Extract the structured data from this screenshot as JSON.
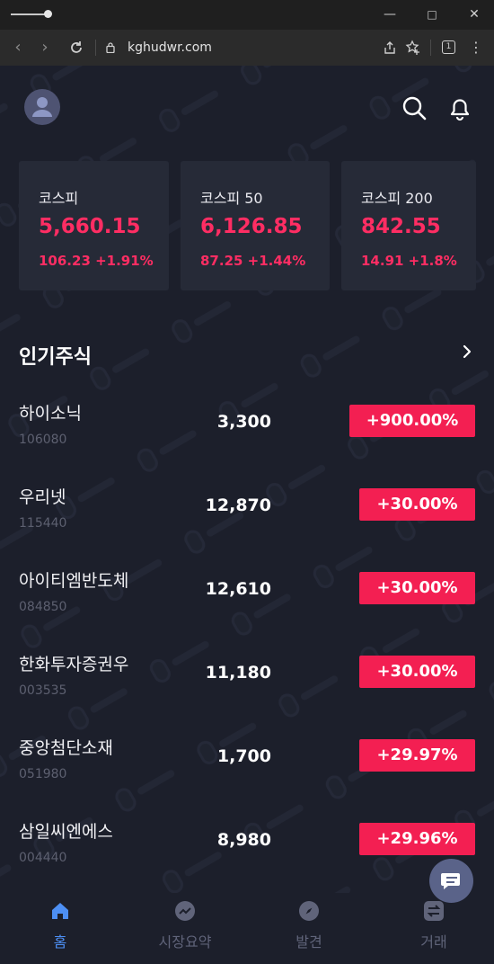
{
  "browser": {
    "url": "kghudwr.com",
    "tab_count": "1"
  },
  "indices": [
    {
      "name": "코스피",
      "value": "5,660.15",
      "change": "106.23 +1.91%"
    },
    {
      "name": "코스피 50",
      "value": "6,126.85",
      "change": "87.25 +1.44%"
    },
    {
      "name": "코스피 200",
      "value": "842.55",
      "change": "14.91 +1.8%"
    }
  ],
  "popular": {
    "title": "인기주식",
    "stocks": [
      {
        "name": "하이소닉",
        "code": "106080",
        "price": "3,300",
        "change": "+900.00%"
      },
      {
        "name": "우리넷",
        "code": "115440",
        "price": "12,870",
        "change": "+30.00%"
      },
      {
        "name": "아이티엠반도체",
        "code": "084850",
        "price": "12,610",
        "change": "+30.00%"
      },
      {
        "name": "한화투자증권우",
        "code": "003535",
        "price": "11,180",
        "change": "+30.00%"
      },
      {
        "name": "중앙첨단소재",
        "code": "051980",
        "price": "1,700",
        "change": "+29.97%"
      },
      {
        "name": "삼일씨엔에스",
        "code": "004440",
        "price": "8,980",
        "change": "+29.96%"
      }
    ]
  },
  "bottom_nav": [
    {
      "label": "홈",
      "icon": "home-icon",
      "active": true
    },
    {
      "label": "시장요약",
      "icon": "trend-icon",
      "active": false
    },
    {
      "label": "발견",
      "icon": "compass-icon",
      "active": false
    },
    {
      "label": "거래",
      "icon": "transfer-icon",
      "active": false
    }
  ],
  "colors": {
    "background": "#1c1f2b",
    "card": "#262a37",
    "up": "#ff2d63",
    "badge": "#f31f52",
    "active_nav": "#4d8ff4"
  }
}
